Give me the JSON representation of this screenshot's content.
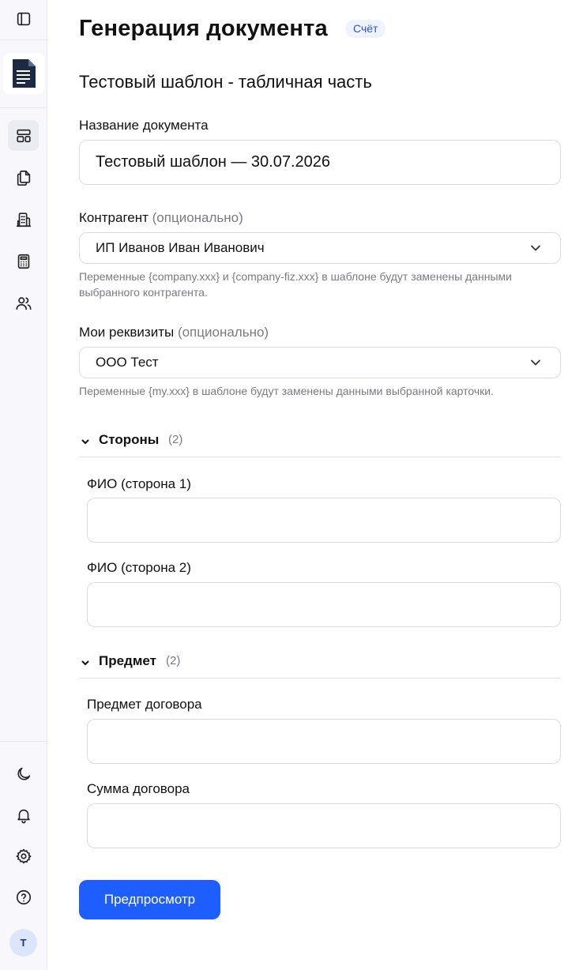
{
  "header": {
    "title": "Генерация документа",
    "badge": "Счёт"
  },
  "template_name": "Тестовый шаблон - табличная часть",
  "fields": {
    "doc_name": {
      "label": "Название документа",
      "value": "Тестовый шаблон — 30.07.2026"
    },
    "counterparty": {
      "label": "Контрагент",
      "optional": "(опционально)",
      "value": "ИП Иванов Иван Иванович",
      "hint": "Переменные {company.xxx} и {company-fiz.xxx} в шаблоне будут заменены данными выбранного контрагента."
    },
    "my_details": {
      "label": "Мои реквизиты",
      "optional": "(опционально)",
      "value": "ООО Тест",
      "hint": "Переменные {my.xxx} в шаблоне будут заменены данными выбранной карточки."
    }
  },
  "sections": [
    {
      "title": "Стороны",
      "count": "(2)",
      "fields": [
        {
          "label": "ФИО (сторона 1)",
          "value": ""
        },
        {
          "label": "ФИО (сторона 2)",
          "value": ""
        }
      ]
    },
    {
      "title": "Предмет",
      "count": "(2)",
      "fields": [
        {
          "label": "Предмет договора",
          "value": ""
        },
        {
          "label": "Сумма договора",
          "value": ""
        }
      ]
    }
  ],
  "actions": {
    "preview": "Предпросмотр"
  },
  "sidebar": {
    "items": [
      {
        "icon": "sidebar-toggle-icon"
      },
      {
        "icon": "layout-icon",
        "active": true
      },
      {
        "icon": "documents-icon"
      },
      {
        "icon": "building-icon"
      },
      {
        "icon": "calculator-icon"
      },
      {
        "icon": "users-icon"
      },
      {
        "icon": "moon-icon"
      },
      {
        "icon": "bell-icon"
      },
      {
        "icon": "gear-icon"
      },
      {
        "icon": "help-icon"
      }
    ],
    "avatar": "T"
  },
  "colors": {
    "primary": "#1e5eff",
    "badge_bg": "#eef3fd",
    "badge_text": "#2a55d6",
    "sidebar_bg": "#f8f8fc",
    "logo": "#1c2a44"
  }
}
